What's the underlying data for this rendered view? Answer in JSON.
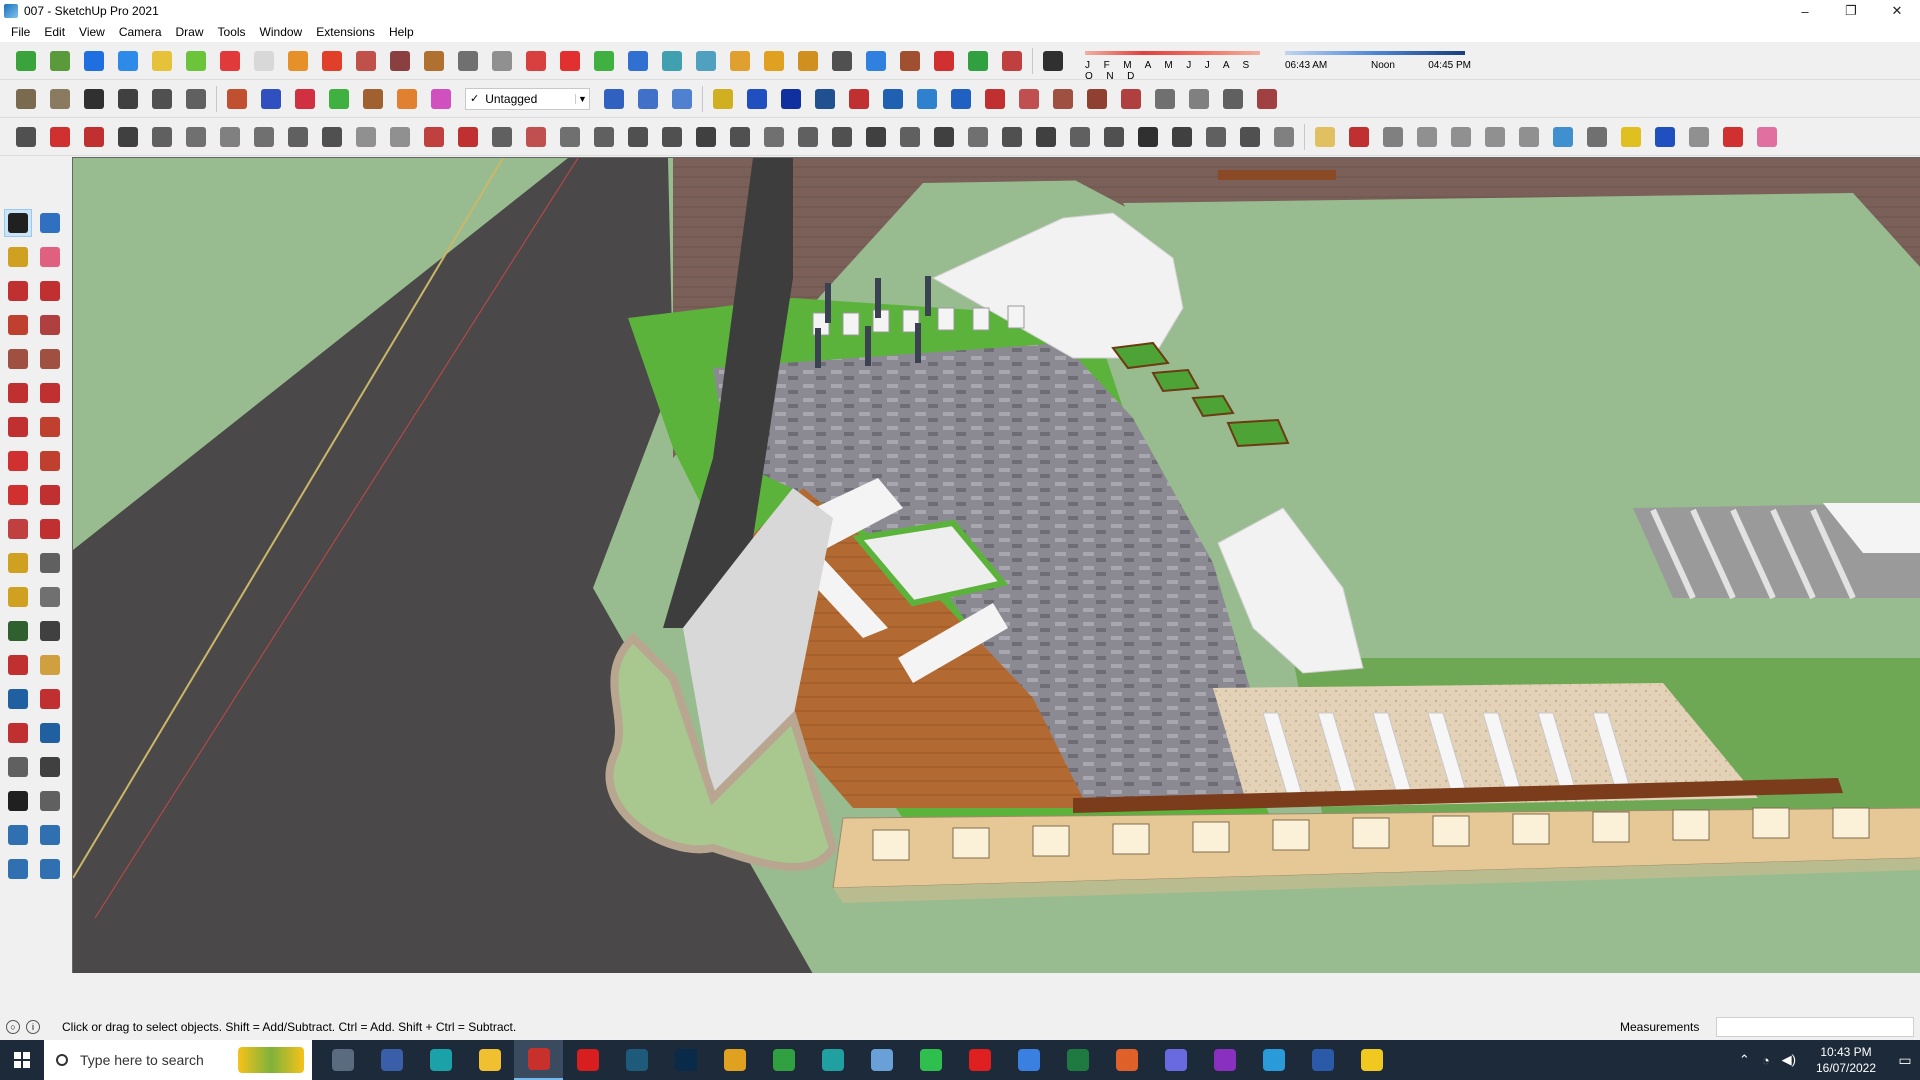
{
  "window": {
    "title": "007 - SketchUp Pro 2021",
    "controls": [
      "–",
      "❐",
      "✕"
    ]
  },
  "menu": [
    "File",
    "Edit",
    "View",
    "Camera",
    "Draw",
    "Tools",
    "Window",
    "Extensions",
    "Help"
  ],
  "toolbar": {
    "tag_value": "Untagged",
    "tag_check": "✓",
    "shadow_months": "J F M A M J J A S O N D",
    "time_start": "06:43 AM",
    "time_mid": "Noon",
    "time_end": "04:45 PM"
  },
  "status": {
    "hint": "Click or drag to select objects. Shift = Add/Subtract. Ctrl = Add. Shift + Ctrl = Subtract.",
    "measurements_label": "Measurements"
  },
  "taskbar": {
    "search_placeholder": "Type here to search",
    "time": "10:43 PM",
    "date": "16/07/2022"
  },
  "colors": {
    "grass": "#98bc8f",
    "road": "#4a4848",
    "paving": "#7c6259",
    "accent_green": "#5cb33b"
  }
}
